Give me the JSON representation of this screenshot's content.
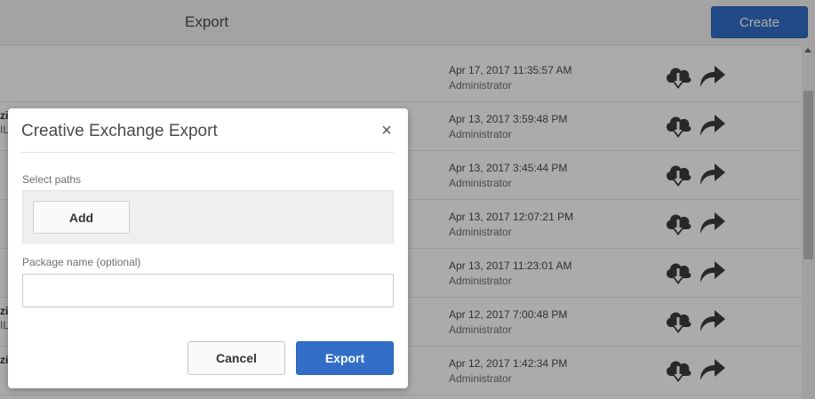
{
  "header": {
    "title": "Export",
    "create_label": "Create"
  },
  "rows": [
    {
      "name_fragment": "",
      "sub_fragment": "",
      "date": "Apr 17, 2017 11:35:57 AM",
      "user": "Administrator"
    },
    {
      "name_fragment": "zi",
      "sub_fragment": "IL",
      "date": "Apr 13, 2017 3:59:48 PM",
      "user": "Administrator"
    },
    {
      "name_fragment": "",
      "sub_fragment": "",
      "date": "Apr 13, 2017 3:45:44 PM",
      "user": "Administrator"
    },
    {
      "name_fragment": "",
      "sub_fragment": "",
      "date": "Apr 13, 2017 12:07:21 PM",
      "user": "Administrator"
    },
    {
      "name_fragment": "",
      "sub_fragment": "",
      "date": "Apr 13, 2017 11:23:01 AM",
      "user": "Administrator"
    },
    {
      "name_fragment": "zi",
      "sub_fragment": "IL",
      "date": "Apr 12, 2017 7:00:48 PM",
      "user": "Administrator"
    },
    {
      "name_fragment": "zi",
      "sub_fragment": "",
      "date": "Apr 12, 2017 1:42:34 PM",
      "user": "Administrator"
    }
  ],
  "row_icons": [
    "cloud-download-icon",
    "share-arrow-icon"
  ],
  "dialog": {
    "title": "Creative Exchange Export",
    "close_glyph": "×",
    "select_paths_label": "Select paths",
    "add_label": "Add",
    "package_name_label": "Package name (optional)",
    "package_name_value": "",
    "cancel_label": "Cancel",
    "export_label": "Export"
  },
  "colors": {
    "primary": "#326ec8",
    "overlay": "rgba(0,0,0,0.33)",
    "icon": "#3c3c3c"
  }
}
